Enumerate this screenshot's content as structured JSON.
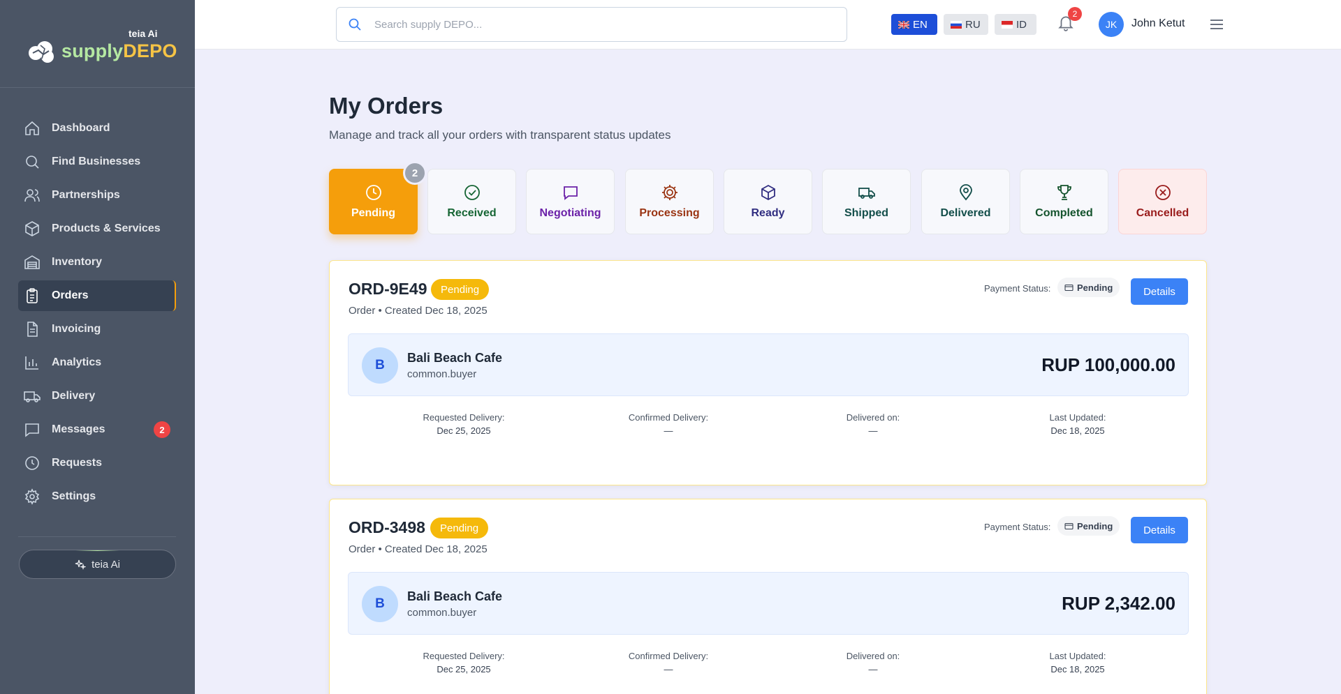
{
  "brand": {
    "teia_label": "teia Ai",
    "name_part1": "supply",
    "name_part2": "DEPO"
  },
  "sidebar": {
    "items": [
      {
        "label": "Dashboard",
        "icon": "home-icon"
      },
      {
        "label": "Find Businesses",
        "icon": "search-icon"
      },
      {
        "label": "Partnerships",
        "icon": "users-icon"
      },
      {
        "label": "Products & Services",
        "icon": "box-icon"
      },
      {
        "label": "Inventory",
        "icon": "warehouse-icon"
      },
      {
        "label": "Orders",
        "icon": "clipboard-icon",
        "active": true
      },
      {
        "label": "Invoicing",
        "icon": "file-icon"
      },
      {
        "label": "Analytics",
        "icon": "bar-chart-icon"
      },
      {
        "label": "Delivery",
        "icon": "truck-icon"
      },
      {
        "label": "Messages",
        "icon": "message-icon",
        "badge": "2"
      },
      {
        "label": "Requests",
        "icon": "clock-icon"
      },
      {
        "label": "Settings",
        "icon": "gear-icon"
      }
    ],
    "teia_button": "teia Ai"
  },
  "topbar": {
    "search_placeholder": "Search supply DEPO...",
    "languages": [
      "EN",
      "RU",
      "ID"
    ],
    "notifications_count": "2",
    "user_initials": "JK",
    "user_name": "John Ketut"
  },
  "main": {
    "title": "My Orders",
    "subtitle": "Manage and track all your orders with transparent status updates",
    "tabs": [
      {
        "label": "Pending",
        "count": "2",
        "color": "#f59e0b"
      },
      {
        "label": "Received",
        "color": "#166534"
      },
      {
        "label": "Negotiating",
        "color": "#6b21a8"
      },
      {
        "label": "Processing",
        "color": "#9a3412"
      },
      {
        "label": "Ready",
        "color": "#312e81"
      },
      {
        "label": "Shipped",
        "color": "#134e4a"
      },
      {
        "label": "Delivered",
        "color": "#134e4a"
      },
      {
        "label": "Completed",
        "color": "#14532d"
      },
      {
        "label": "Cancelled",
        "color": "#991b1b"
      }
    ],
    "orders": [
      {
        "id": "ORD-9E49",
        "status": "Pending",
        "meta": "Order • Created Dec 18, 2025",
        "payment_label": "Payment Status:",
        "payment_status": "Pending",
        "details_label": "Details",
        "buyer_initial": "B",
        "buyer_name": "Bali Beach Cafe",
        "buyer_role": "common.buyer",
        "amount": "RUP 100,000.00",
        "dates": [
          {
            "label": "Requested Delivery:",
            "value": "Dec 25, 2025"
          },
          {
            "label": "Confirmed Delivery:",
            "value": "—"
          },
          {
            "label": "Delivered on:",
            "value": "—"
          },
          {
            "label": "Last Updated:",
            "value": "Dec 18, 2025"
          }
        ]
      },
      {
        "id": "ORD-3498",
        "status": "Pending",
        "meta": "Order • Created Dec 18, 2025",
        "payment_label": "Payment Status:",
        "payment_status": "Pending",
        "details_label": "Details",
        "buyer_initial": "B",
        "buyer_name": "Bali Beach Cafe",
        "buyer_role": "common.buyer",
        "amount": "RUP 2,342.00",
        "dates": [
          {
            "label": "Requested Delivery:",
            "value": "Dec 25, 2025"
          },
          {
            "label": "Confirmed Delivery:",
            "value": "—"
          },
          {
            "label": "Delivered on:",
            "value": "—"
          },
          {
            "label": "Last Updated:",
            "value": "Dec 18, 2025"
          }
        ]
      }
    ]
  }
}
